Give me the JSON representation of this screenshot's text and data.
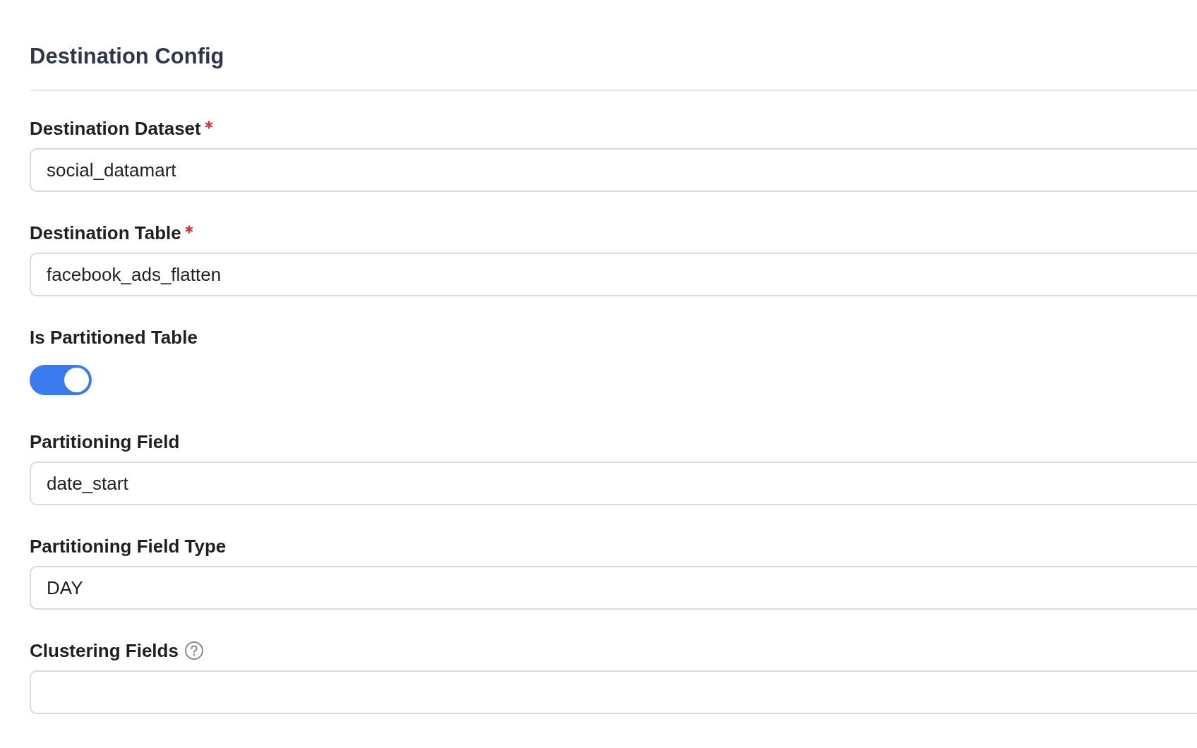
{
  "section": {
    "title": "Destination Config"
  },
  "fields": [
    {
      "kind": "text",
      "label": "Destination Dataset",
      "required": true,
      "value": "social_datamart"
    },
    {
      "kind": "text",
      "label": "Destination Table",
      "required": true,
      "value": "facebook_ads_flatten"
    },
    {
      "kind": "toggle",
      "label": "Is Partitioned Table",
      "on": true
    },
    {
      "kind": "text",
      "label": "Partitioning Field",
      "value": "date_start"
    },
    {
      "kind": "text",
      "label": "Partitioning Field Type",
      "value": "DAY"
    },
    {
      "kind": "text",
      "label": "Clustering Fields",
      "help": true
    }
  ]
}
